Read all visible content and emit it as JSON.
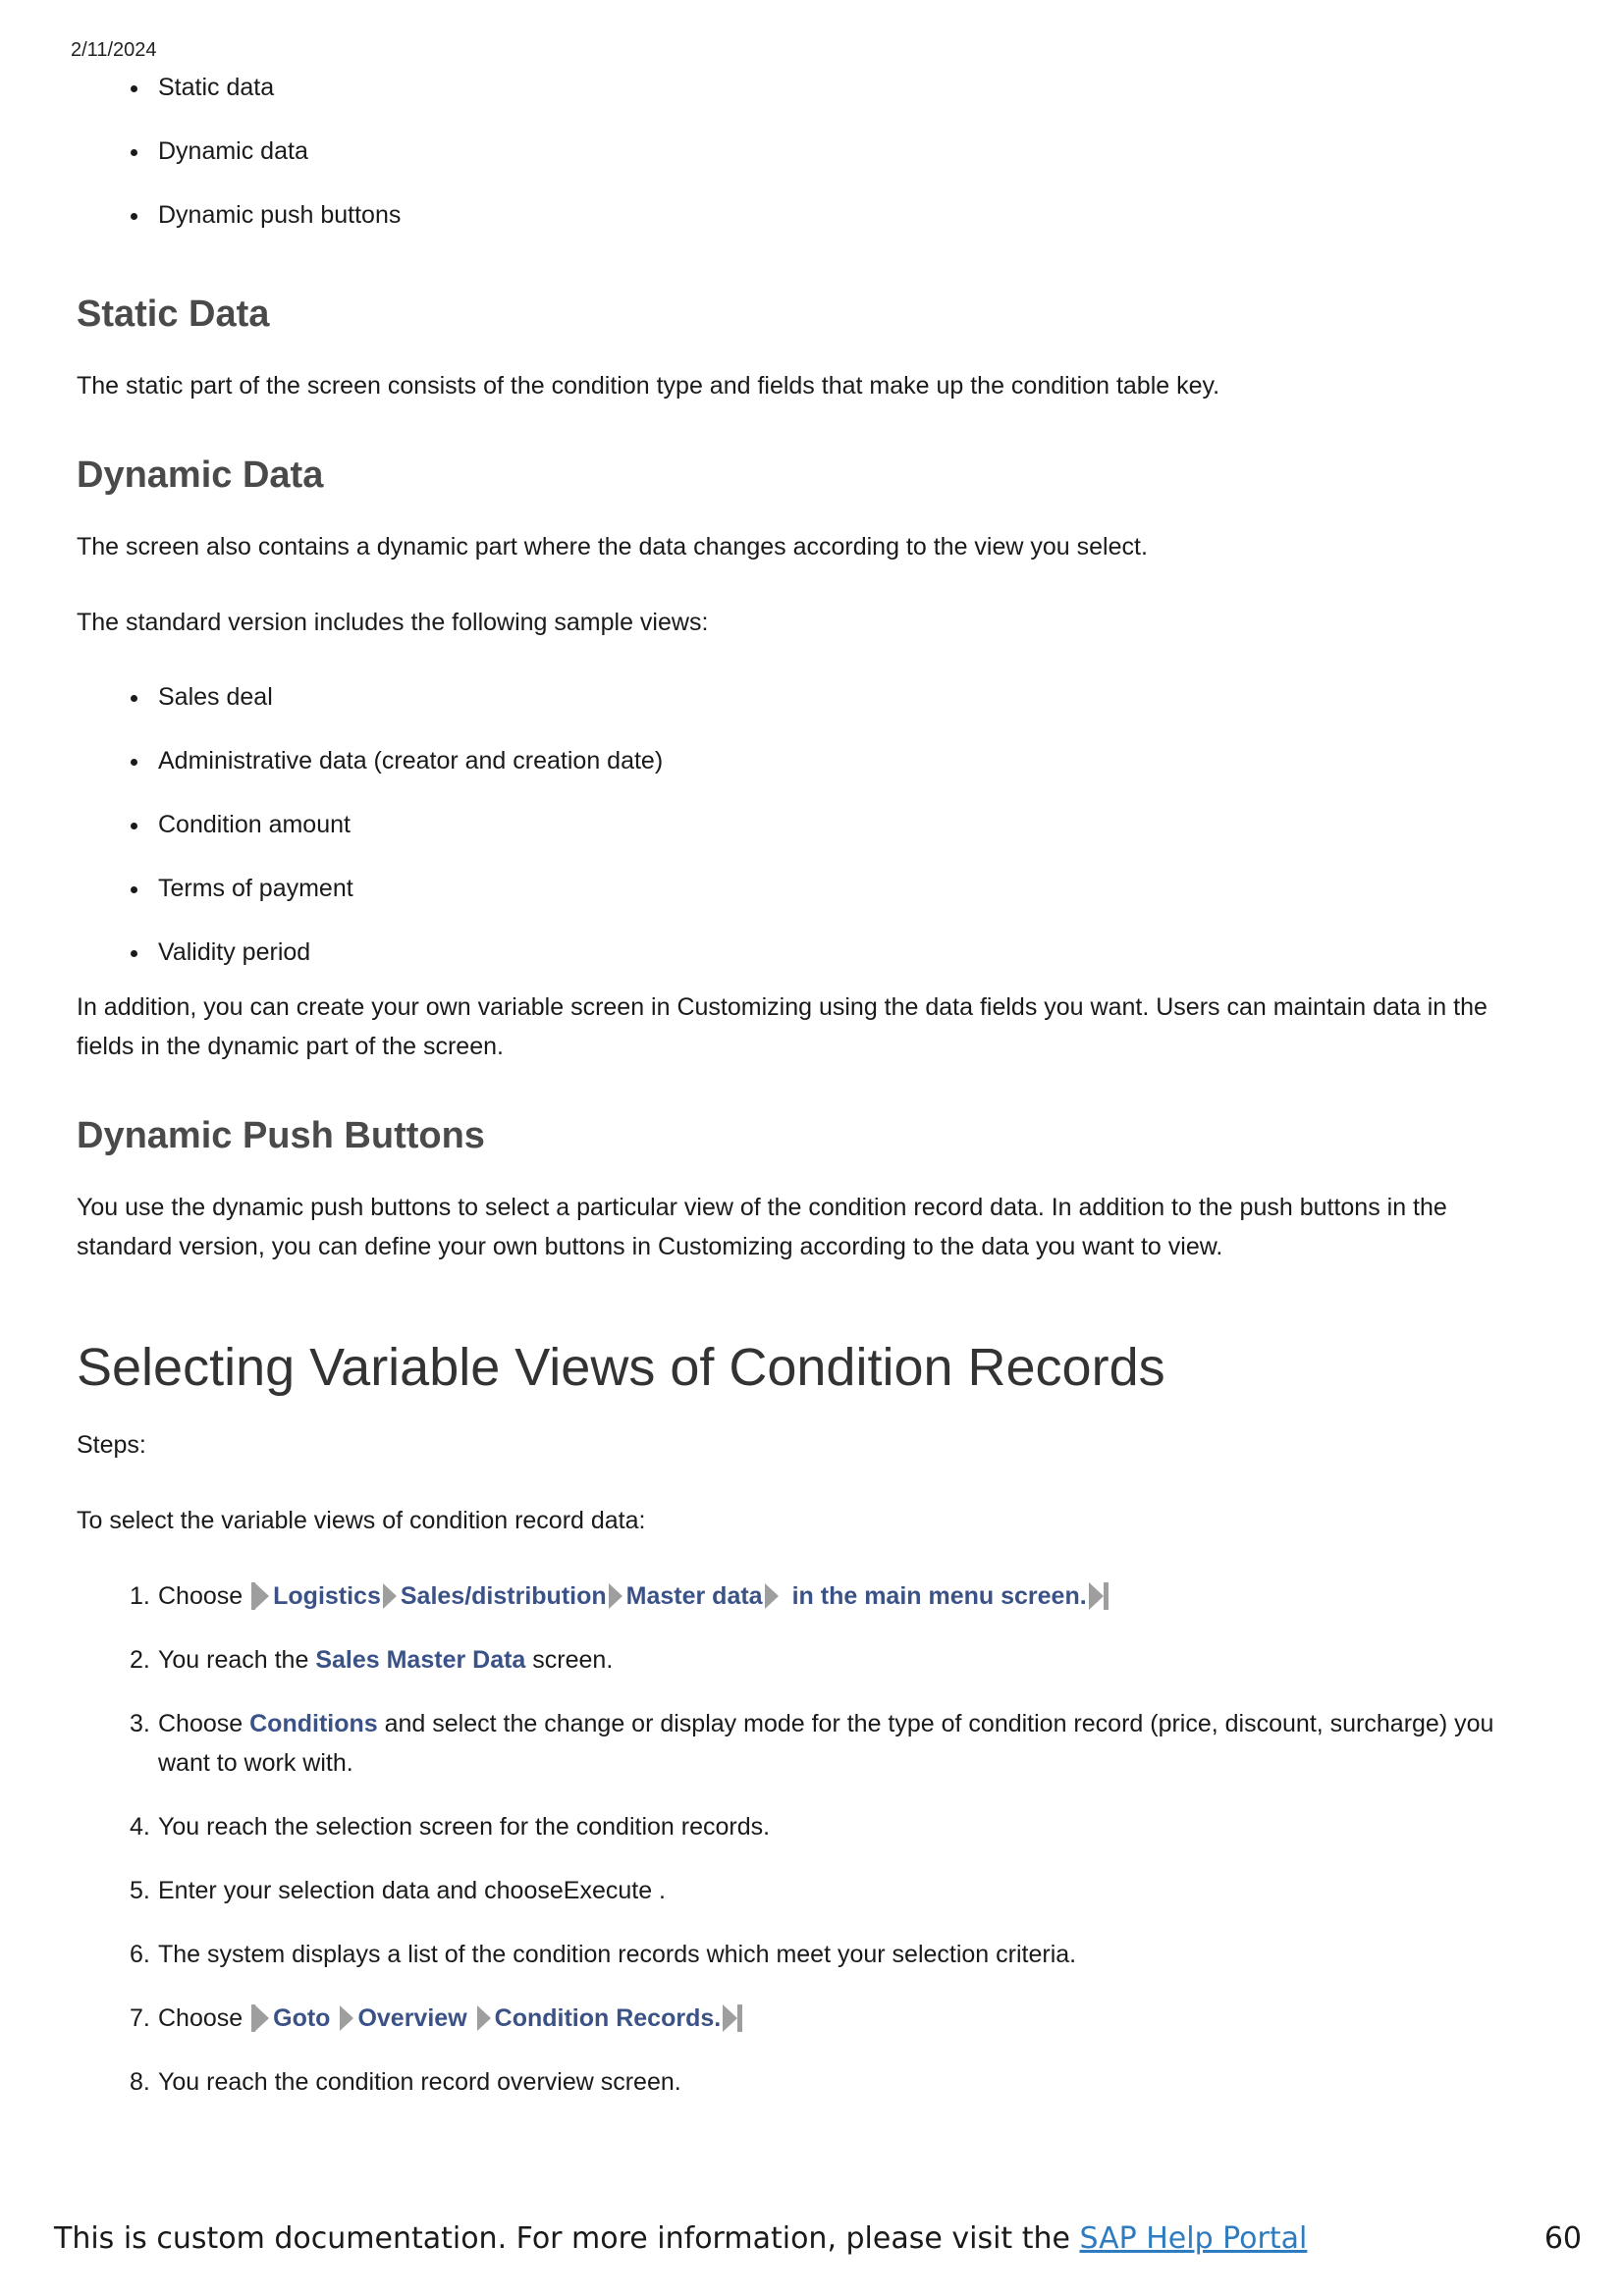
{
  "header": {
    "date": "2/11/2024"
  },
  "intro_bullets": [
    "Static data",
    "Dynamic data",
    "Dynamic push buttons"
  ],
  "static_data": {
    "heading": "Static Data",
    "text": "The static part of the screen consists of the condition type and fields that make up the condition table key."
  },
  "dynamic_data": {
    "heading": "Dynamic Data",
    "text1": "The screen also contains a dynamic part where the data changes according to the view you select.",
    "text2": "The standard version includes the following sample views:",
    "views": [
      "Sales deal",
      "Administrative data (creator and creation date)",
      "Condition amount",
      "Terms of payment",
      "Validity period"
    ],
    "text3": "In addition, you can create your own variable screen in Customizing using the data fields you want. Users can maintain data in the fields in the dynamic part of the screen."
  },
  "push_buttons": {
    "heading": "Dynamic Push Buttons",
    "text": "You use the dynamic push buttons to select a particular view of the condition record data. In addition to the push buttons in the standard version, you can define your own buttons in Customizing according to the data you want to view."
  },
  "selecting": {
    "title": "Selecting Variable Views of Condition Records",
    "steps_label": "Steps:",
    "intro": "To select the variable views of condition record data:",
    "step1": {
      "num": "1.",
      "prefix": "Choose ",
      "path": [
        "Logistics",
        "Sales/distribution",
        "Master data",
        "in the main menu screen."
      ]
    },
    "step2": {
      "num": "2.",
      "prefix": "You reach the ",
      "link": "Sales Master Data",
      "suffix": " screen."
    },
    "step3": {
      "num": "3.",
      "prefix": "Choose ",
      "link": "Conditions",
      "suffix": " and select the change or display mode for the type of condition record (price, discount, surcharge) you want to work with."
    },
    "step4": {
      "num": "4.",
      "text": "You reach the selection screen for the condition records."
    },
    "step5": {
      "num": "5.",
      "text": "Enter your selection data and chooseExecute ."
    },
    "step6": {
      "num": "6.",
      "text": "The system displays a list of the condition records which meet your selection criteria."
    },
    "step7": {
      "num": "7.",
      "prefix": "Choose ",
      "path": [
        "Goto",
        "Overview",
        "Condition Records."
      ]
    },
    "step8": {
      "num": "8.",
      "text": "You reach the condition record overview screen."
    }
  },
  "footer": {
    "text": "This is custom documentation. For more information, please visit the ",
    "link": "SAP Help Portal",
    "page": "60"
  },
  "colors": {
    "link": "#3b5287",
    "heading": "#4a4a4a",
    "footer_link": "#2e7bbf",
    "arrow": "#9e9e9e"
  }
}
